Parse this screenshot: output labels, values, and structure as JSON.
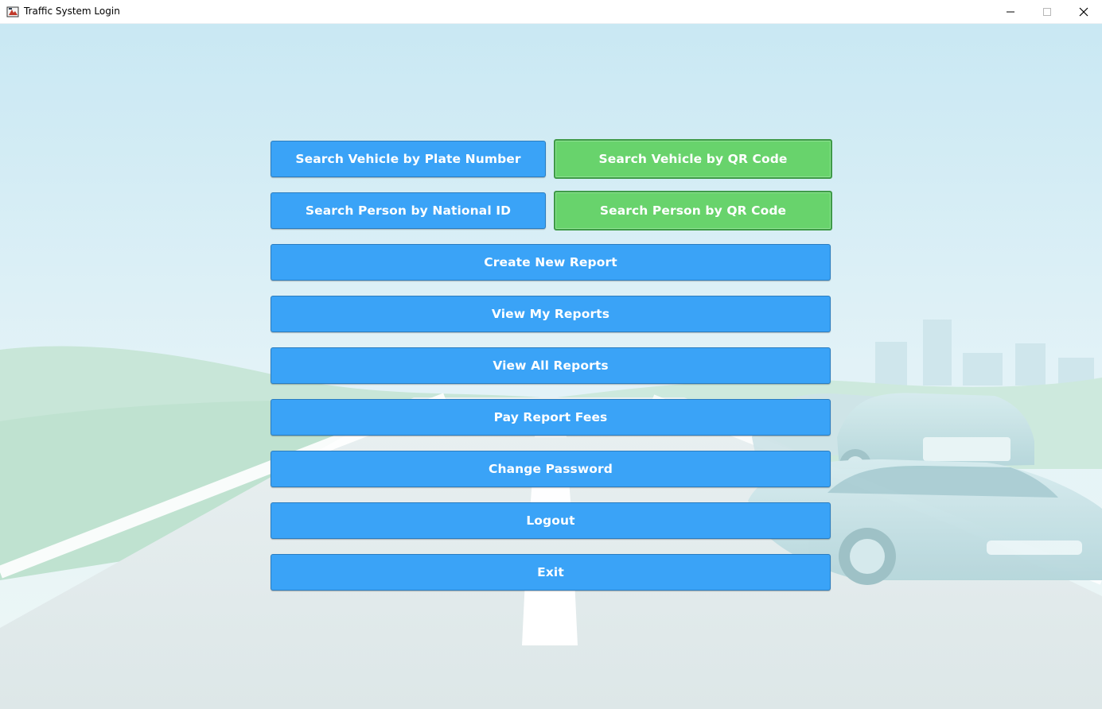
{
  "window": {
    "title": "Traffic System Login"
  },
  "controls": {
    "minimize_icon": "minimize-icon",
    "maximize_icon": "maximize-icon",
    "close_icon": "close-icon"
  },
  "menu": {
    "search_vehicle_plate": "Search Vehicle by Plate Number",
    "search_vehicle_qr": "Search Vehicle by QR Code",
    "search_person_national_id": "Search Person by National ID",
    "search_person_qr": "Search Person by QR Code",
    "create_new_report": "Create New Report",
    "view_my_reports": "View My Reports",
    "view_all_reports": "View All Reports",
    "pay_report_fees": "Pay Report Fees",
    "change_password": "Change Password",
    "logout": "Logout",
    "exit": "Exit"
  },
  "colors": {
    "primary_button": "#3aa3f7",
    "qr_button": "#68d36c",
    "qr_button_border": "#3f9a48"
  }
}
